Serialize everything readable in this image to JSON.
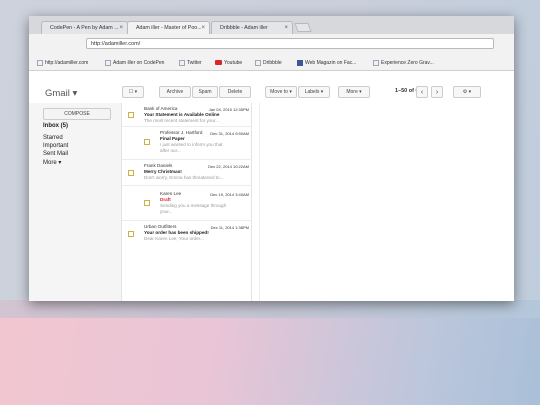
{
  "browser": {
    "tabs": [
      {
        "label": "CodePen - A Pen by Adam ..."
      },
      {
        "label": "Adam iller - Master of Poo..."
      },
      {
        "label": "Dribbble - Adam iller"
      }
    ],
    "url": "http://adamiller.com/",
    "bookmarks": [
      {
        "label": "http://adamiller.com",
        "icon": "page-icon"
      },
      {
        "label": "Adam iller on CodePen",
        "icon": "page-icon"
      },
      {
        "label": "Twitter",
        "icon": "page-icon"
      },
      {
        "label": "Youtube",
        "icon": "youtube-icon"
      },
      {
        "label": "Dribbble",
        "icon": "page-icon"
      },
      {
        "label": "Web Magazin on Fac...",
        "icon": "facebook-icon"
      },
      {
        "label": "Experience Zero Grav...",
        "icon": "page-icon"
      }
    ]
  },
  "gmail": {
    "logo": "Gmail ▾",
    "compose": "COMPOSE",
    "nav": [
      "Inbox (5)",
      "Starred",
      "Important",
      "Sent Mail",
      "More ▾"
    ],
    "toolbar": {
      "select": "☐ ▾",
      "archive": "Archive",
      "spam": "Spam",
      "delete": "Delete",
      "move_to": "Move to ▾",
      "labels": "Labels ▾",
      "more": "More ▾",
      "pager": "1–50 of 680",
      "prev": "‹",
      "next": "›",
      "settings": "⚙ ▾"
    },
    "messages": [
      {
        "from": "Bank of America",
        "date": "Jan 04, 2015 12:35PM",
        "subject": "Your Statement is Available Online",
        "snippet": "The most recent statement for your..."
      },
      {
        "from": "Professor J. Hartford",
        "date": "Dec 31, 2014 9:50AM",
        "subject": "Final Paper",
        "snippet": "I just wanted to inform you that after our..."
      },
      {
        "from": "Frank Daniels",
        "date": "Dec 22, 2014 10:22AM",
        "subject": "Merry Christmas!",
        "snippet": "Don't worry, Emma has threatened to..."
      },
      {
        "from": "Karen Lee",
        "date": "Dec 19, 2014 3:40AM",
        "subject": "Draft",
        "snippet": "Sending you a message through your..."
      },
      {
        "from": "Urban Outfitters",
        "date": "Dec 11, 2014 1:38PM",
        "subject": "Your order has been shipped!",
        "snippet": "Dear Karen Lee, Your order..."
      }
    ]
  },
  "colors": {
    "draft_red": "#dd2233",
    "youtube_red": "#d8262b",
    "facebook_blue": "#3b5998"
  }
}
